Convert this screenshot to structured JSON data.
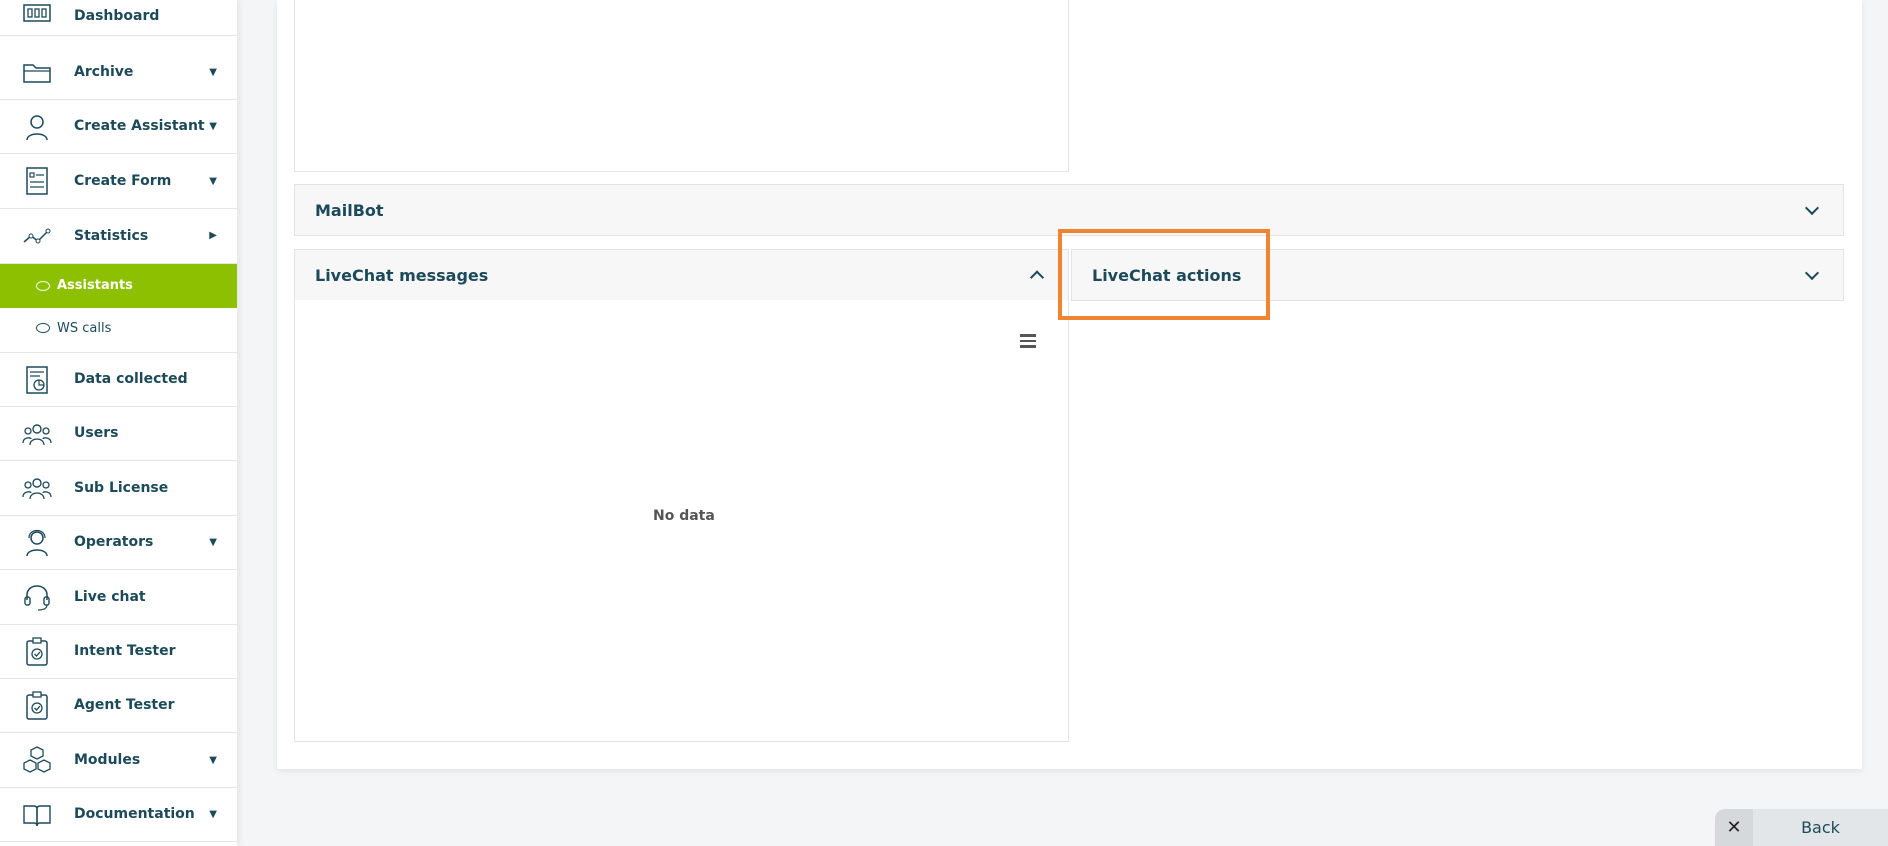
{
  "sidebar": {
    "items": [
      {
        "label": "Dashboard",
        "icon": "dashboard-icon"
      },
      {
        "label": "Archive",
        "icon": "folder-icon"
      },
      {
        "label": "Create Assistant",
        "icon": "assistant-icon"
      },
      {
        "label": "Create Form",
        "icon": "form-icon"
      },
      {
        "label": "Statistics",
        "icon": "statistics-icon"
      },
      {
        "label": "Data collected",
        "icon": "data-collected-icon"
      },
      {
        "label": "Users",
        "icon": "users-icon"
      },
      {
        "label": "Sub License",
        "icon": "sub-license-icon"
      },
      {
        "label": "Operators",
        "icon": "operators-icon"
      },
      {
        "label": "Live chat",
        "icon": "headset-icon"
      },
      {
        "label": "Intent Tester",
        "icon": "clipboard-check-icon"
      },
      {
        "label": "Agent Tester",
        "icon": "clipboard-check-icon"
      },
      {
        "label": "Modules",
        "icon": "cubes-icon"
      },
      {
        "label": "Documentation",
        "icon": "book-icon"
      }
    ],
    "statistics_sub": [
      {
        "label": "Assistants",
        "active": true
      },
      {
        "label": "WS calls",
        "active": false
      }
    ]
  },
  "main": {
    "sections": {
      "mailbot": {
        "title": "MailBot"
      },
      "livechat_messages": {
        "title": "LiveChat messages",
        "empty_text": "No data"
      },
      "livechat_actions": {
        "title": "LiveChat actions"
      }
    }
  },
  "footer": {
    "back_label": "Back",
    "close_symbol": "✕"
  },
  "colors": {
    "accent": "#8dc000",
    "text": "#1d4a5a",
    "highlight": "#f08430"
  }
}
